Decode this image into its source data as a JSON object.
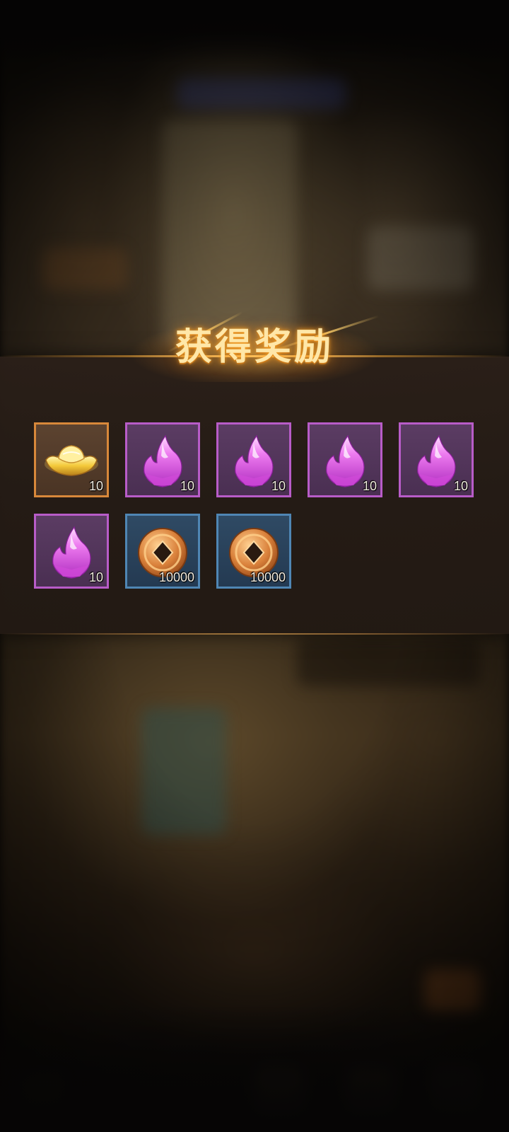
{
  "reward_popup": {
    "title": "获得奖励",
    "items": [
      {
        "type": "gold-ingot",
        "quantity": "10",
        "rarity": "orange"
      },
      {
        "type": "purple-crystal",
        "quantity": "10",
        "rarity": "purple"
      },
      {
        "type": "purple-crystal",
        "quantity": "10",
        "rarity": "purple"
      },
      {
        "type": "purple-crystal",
        "quantity": "10",
        "rarity": "purple"
      },
      {
        "type": "purple-crystal",
        "quantity": "10",
        "rarity": "purple"
      },
      {
        "type": "purple-crystal",
        "quantity": "10",
        "rarity": "purple"
      },
      {
        "type": "copper-coin",
        "quantity": "10000",
        "rarity": "blue"
      },
      {
        "type": "copper-coin",
        "quantity": "10000",
        "rarity": "blue"
      }
    ]
  },
  "colors": {
    "title": "#ffe7a8",
    "frame_orange": "#d8883a",
    "frame_purple": "#b85cc8",
    "frame_blue": "#4f86b4"
  }
}
